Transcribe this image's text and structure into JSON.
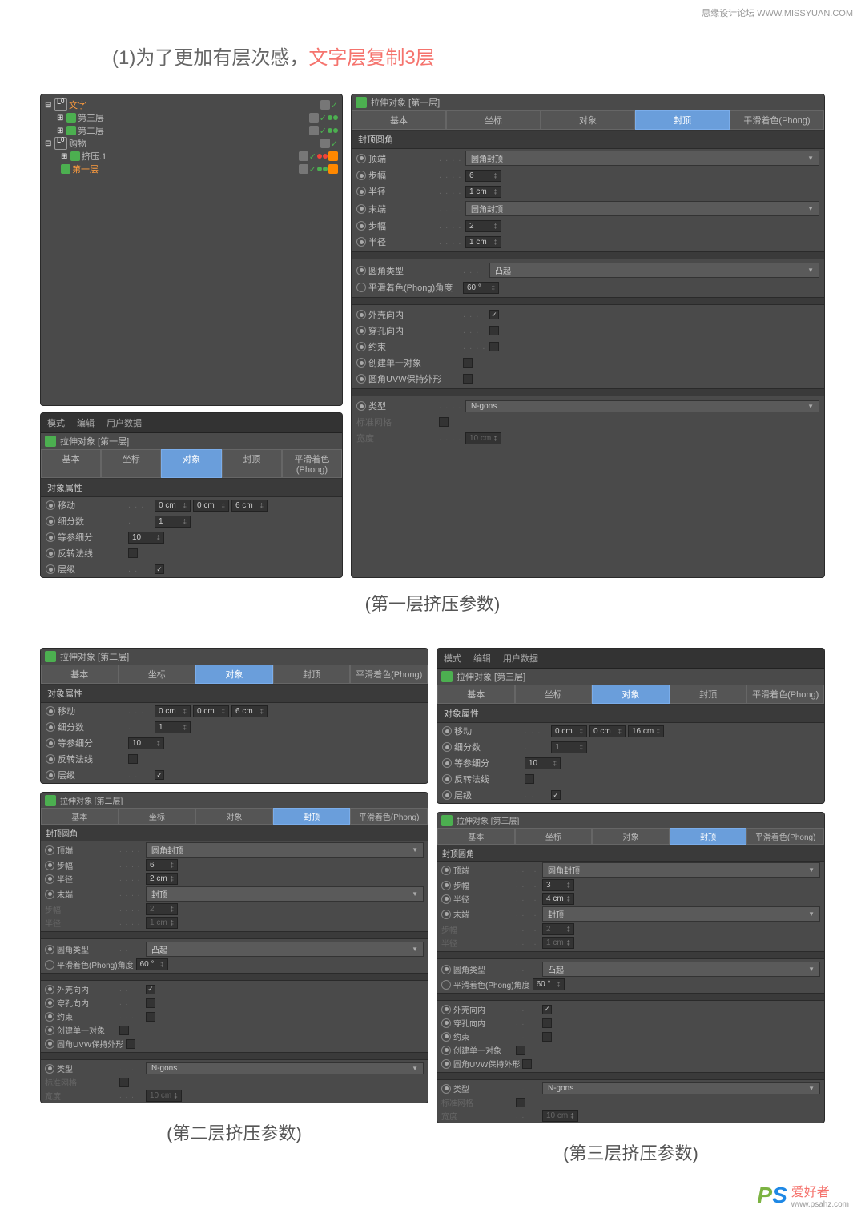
{
  "header": "思缘设计论坛   WWW.MISSYUAN.COM",
  "title_prefix": "(1)为了更加有层次感，",
  "title_red": "文字层复制3层",
  "tree": {
    "root": "文字",
    "items": [
      "第三层",
      "第二层",
      "购物",
      "挤压.1",
      "第一层"
    ]
  },
  "mode_bar": {
    "mode": "模式",
    "edit": "编辑",
    "user_data": "用户数据"
  },
  "obj_title_1": "拉伸对象 [第一层]",
  "obj_title_2": "拉伸对象 [第二层]",
  "obj_title_3": "拉伸对象 [第三层]",
  "tabs": {
    "basic": "基本",
    "coord": "坐标",
    "object": "对象",
    "cap": "封顶",
    "phong": "平滑着色(Phong)"
  },
  "sec_props": "对象属性",
  "sec_cap": "封顶圆角",
  "labels": {
    "move": "移动",
    "subdiv": "细分数",
    "iso": "等参细分",
    "flip": "反转法线",
    "hier": "层级",
    "top": "顶端",
    "step": "步幅",
    "radius": "半径",
    "end": "末端",
    "fillet_type": "圆角类型",
    "phong_angle": "平滑着色(Phong)角度",
    "hull_in": "外壳向内",
    "hole_in": "穿孔向内",
    "constrain": "约束",
    "single": "创建单一对象",
    "keep_uvw": "圆角UVW保持外形",
    "type": "类型",
    "std_grid": "标准网格",
    "width": "宽度"
  },
  "values": {
    "zero_cm": "0 cm",
    "six_cm": "6 cm",
    "sixteen_cm": "16 cm",
    "one": "1",
    "ten": "10",
    "six": "6",
    "two": "2",
    "three": "3",
    "one_cm": "1 cm",
    "two_cm": "2 cm",
    "four_cm": "4 cm",
    "ten_cm": "10 cm",
    "sixty_deg": "60 °",
    "fillet_cap": "圆角封顶",
    "cap": "封顶",
    "convex": "凸起",
    "ngons": "N-gons"
  },
  "caption_1": "(第一层挤压参数)",
  "caption_2": "(第二层挤压参数)",
  "caption_3": "(第三层挤压参数)",
  "footer_text": "爱好者",
  "footer_url": "www.psahz.com"
}
